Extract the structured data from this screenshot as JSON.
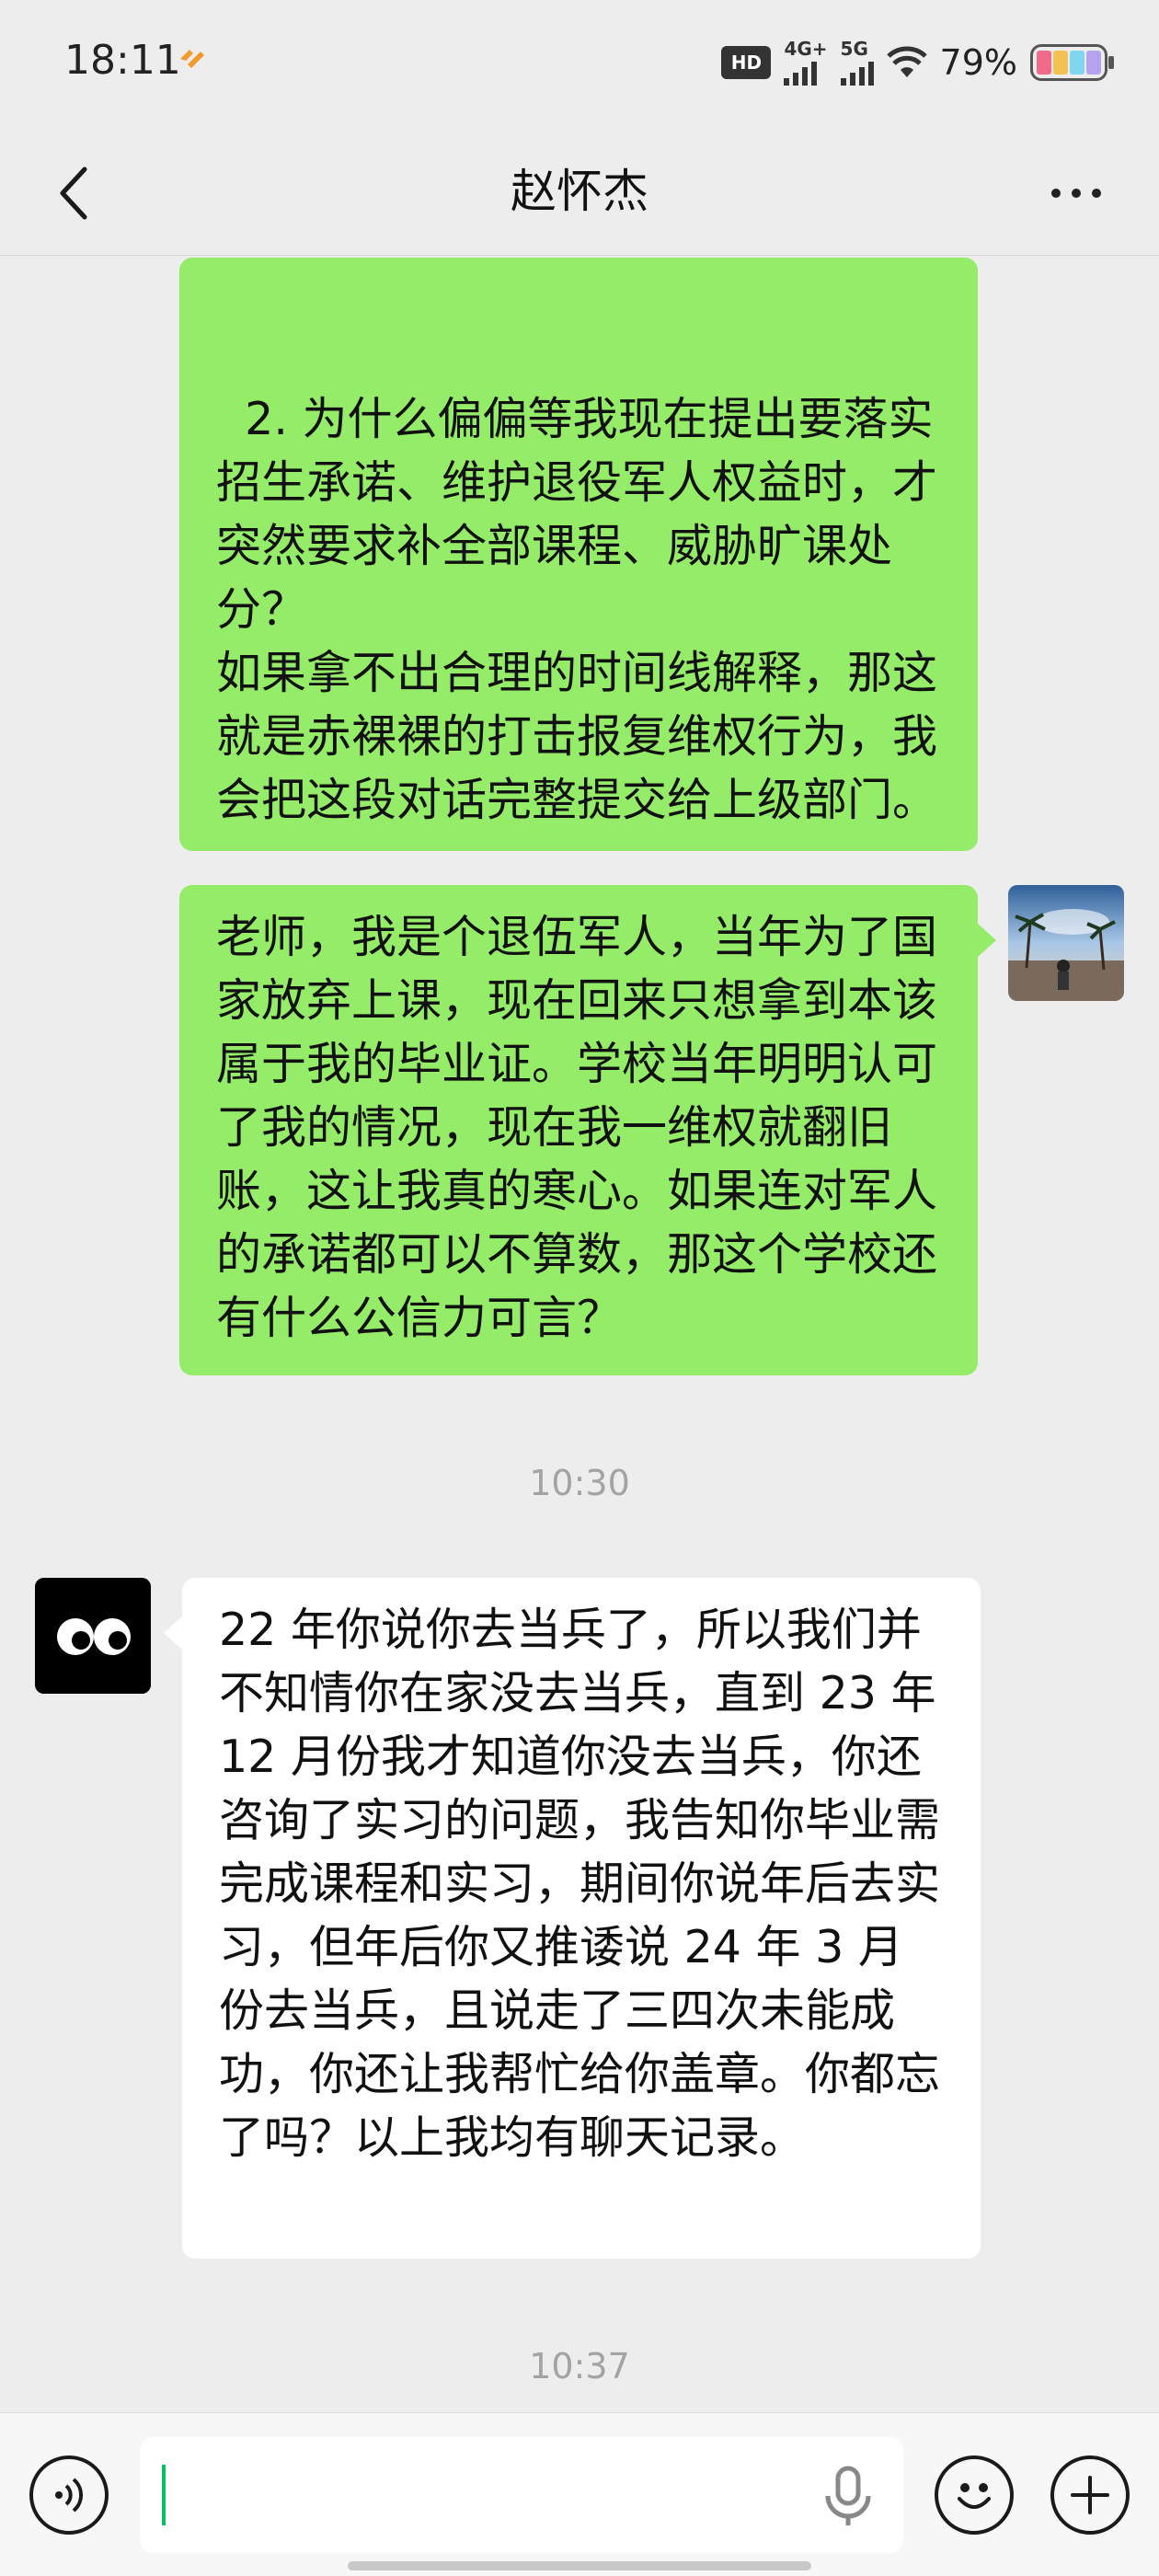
{
  "status_bar": {
    "time": "18:11",
    "hd": "HD",
    "net1": "4G+",
    "net2": "5G",
    "battery_pct": "79%"
  },
  "header": {
    "title": "赵怀杰"
  },
  "messages": [
    {
      "side": "sent",
      "text": "2. 为什么偏偏等我现在提出要落实招生承诺、维护退役军人权益时，才突然要求补全部课程、威胁旷课处分？\n如果拿不出合理的时间线解释，那这就是赤裸裸的打击报复维权行为，我会把这段对话完整提交给上级部门。"
    },
    {
      "side": "sent",
      "text": "老师，我是个退伍军人，当年为了国家放弃上课，现在回来只想拿到本该属于我的毕业证。学校当年明明认可了我的情况，现在我一维权就翻旧账，这让我真的寒心。如果连对军人的承诺都可以不算数，那这个学校还有什么公信力可言？"
    },
    {
      "side": "received",
      "text": "22 年你说你去当兵了，所以我们并不知情你在家没去当兵，直到 23 年 12 月份我才知道你没去当兵，你还咨询了实习的问题，我告知你毕业需完成课程和实习，期间你说年后去实习，但年后你又推诿说 24 年 3 月份去当兵，且说走了三四次未能成功，你还让我帮忙给你盖章。你都忘了吗？以上我均有聊天记录。"
    }
  ],
  "timestamps": [
    "10:30",
    "10:37"
  ],
  "colors": {
    "sent_bubble": "#95ec69",
    "received_bubble": "#ffffff",
    "background": "#ededed",
    "caret": "#07c160"
  },
  "icons": {
    "back": "chevron-left-icon",
    "more": "more-dots-icon",
    "voice": "voice-icon",
    "mic": "microphone-icon",
    "emoji": "emoji-icon",
    "plus": "plus-icon"
  }
}
